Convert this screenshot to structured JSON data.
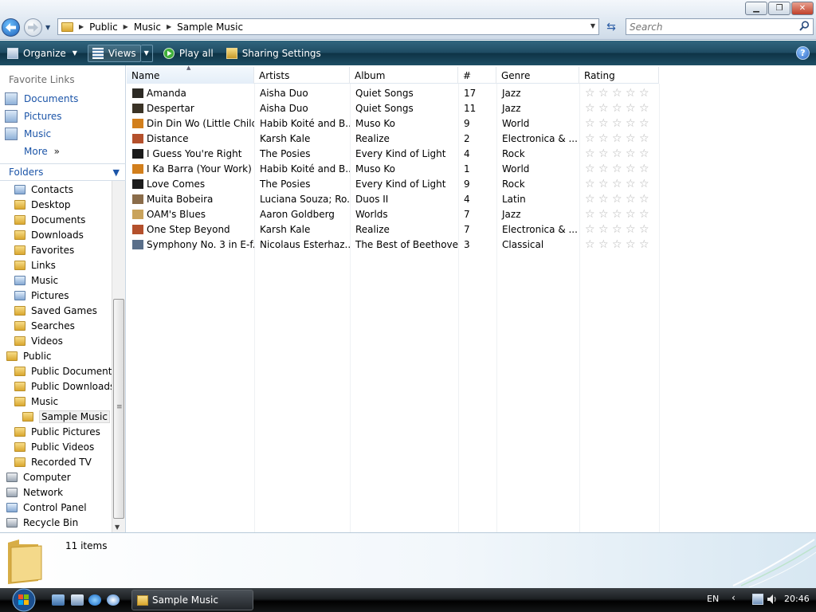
{
  "address_bar": {
    "crumbs": [
      "Public",
      "Music",
      "Sample Music"
    ],
    "search_placeholder": "Search"
  },
  "toolbar": {
    "organize": "Organize",
    "views": "Views",
    "play_all": "Play all",
    "sharing": "Sharing Settings"
  },
  "nav": {
    "favorites_header": "Favorite Links",
    "favorites": [
      "Documents",
      "Pictures",
      "Music"
    ],
    "more": "More",
    "folders_header": "Folders",
    "tree": [
      "Contacts",
      "Desktop",
      "Documents",
      "Downloads",
      "Favorites",
      "Links",
      "Music",
      "Pictures",
      "Saved Games",
      "Searches",
      "Videos",
      "Public",
      "Public Documents",
      "Public Downloads",
      "Music",
      "Sample Music",
      "Public Pictures",
      "Public Videos",
      "Recorded TV",
      "Computer",
      "Network",
      "Control Panel",
      "Recycle Bin"
    ]
  },
  "columns": {
    "name": "Name",
    "artists": "Artists",
    "album": "Album",
    "number": "#",
    "genre": "Genre",
    "rating": "Rating"
  },
  "rows": [
    {
      "name": "Amanda",
      "artist": "Aisha Duo",
      "album": "Quiet Songs",
      "track": "17",
      "genre": "Jazz"
    },
    {
      "name": "Despertar",
      "artist": "Aisha Duo",
      "album": "Quiet Songs",
      "track": "11",
      "genre": "Jazz"
    },
    {
      "name": "Din Din Wo (Little Child)",
      "artist": "Habib Koité and B...",
      "album": "Muso Ko",
      "track": "9",
      "genre": "World"
    },
    {
      "name": "Distance",
      "artist": "Karsh Kale",
      "album": "Realize",
      "track": "2",
      "genre": "Electronica & ..."
    },
    {
      "name": "I Guess You're Right",
      "artist": "The Posies",
      "album": "Every Kind of Light",
      "track": "4",
      "genre": "Rock"
    },
    {
      "name": "I Ka Barra (Your Work)",
      "artist": "Habib Koité and B...",
      "album": "Muso Ko",
      "track": "1",
      "genre": "World"
    },
    {
      "name": "Love Comes",
      "artist": "The Posies",
      "album": "Every Kind of Light",
      "track": "9",
      "genre": "Rock"
    },
    {
      "name": "Muita Bobeira",
      "artist": "Luciana Souza; Ro...",
      "album": "Duos II",
      "track": "4",
      "genre": "Latin"
    },
    {
      "name": "OAM's Blues",
      "artist": "Aaron Goldberg",
      "album": "Worlds",
      "track": "7",
      "genre": "Jazz"
    },
    {
      "name": "One Step Beyond",
      "artist": "Karsh Kale",
      "album": "Realize",
      "track": "7",
      "genre": "Electronica & ..."
    },
    {
      "name": "Symphony No. 3 in E-f...",
      "artist": "Nicolaus Esterhaz...",
      "album": "The Best of Beethoven",
      "track": "3",
      "genre": "Classical"
    }
  ],
  "details": {
    "item_count": "11 items"
  },
  "taskbar": {
    "task_label": "Sample Music",
    "lang": "EN",
    "clock": "20:46"
  }
}
